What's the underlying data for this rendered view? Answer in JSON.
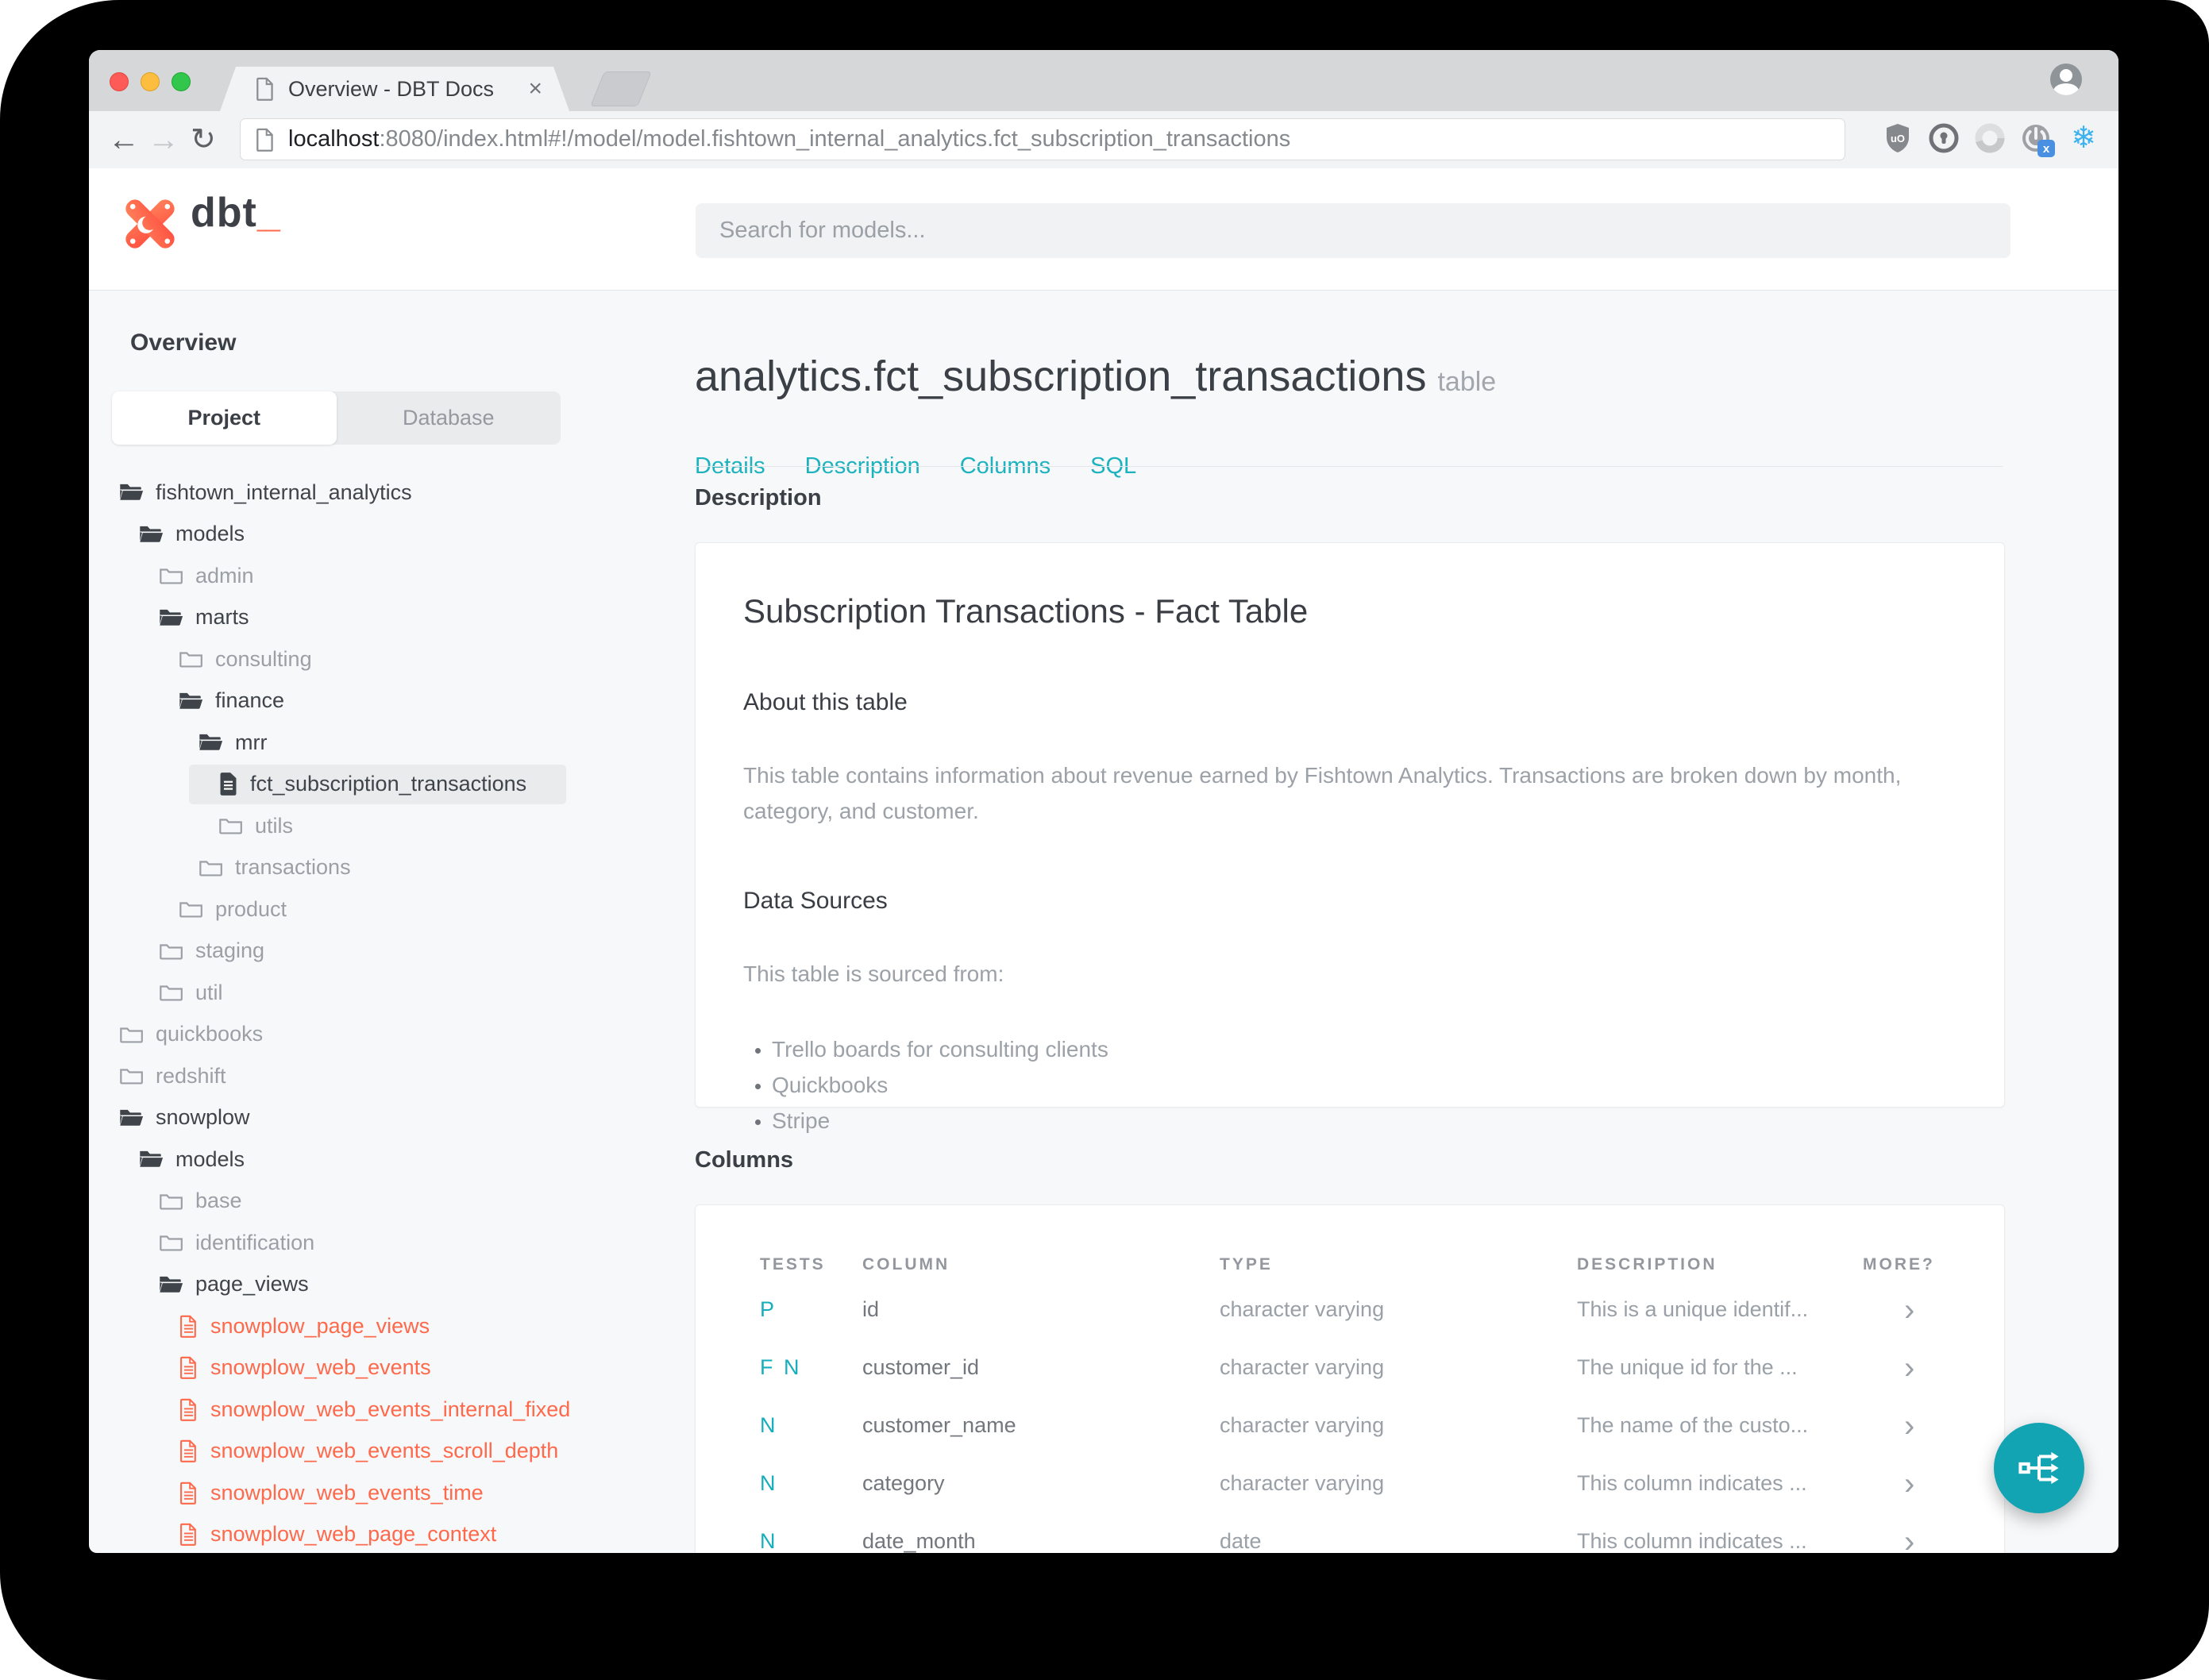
{
  "browser": {
    "tab_title": "Overview - DBT Docs",
    "tab_close_glyph": "×",
    "url": {
      "host": "localhost",
      "rest": ":8080/index.html#!/model/model.fishtown_internal_analytics.fct_subscription_transactions"
    },
    "nav_glyphs": {
      "back": "←",
      "forward": "→",
      "reload": "↻"
    },
    "extension_icons": [
      "shield-icon",
      "keyhole-icon",
      "ring-icon",
      "power-icon",
      "snowflake-icon",
      "overflow-menu-icon"
    ],
    "snowflake_glyph": "❄",
    "menu_glyph": "⋮",
    "ublock_label": "uO",
    "power_badge": "x"
  },
  "header": {
    "logo_text": "dbt",
    "logo_cursor": "_",
    "search_placeholder": "Search for models..."
  },
  "sidebar": {
    "overview_label": "Overview",
    "tabs": {
      "project": "Project",
      "database": "Database"
    },
    "tree": [
      {
        "label": "fishtown_internal_analytics",
        "icon": "folder-open",
        "tone": "dark",
        "indent": 0
      },
      {
        "label": "models",
        "icon": "folder-open",
        "tone": "dark",
        "indent": 1
      },
      {
        "label": "admin",
        "icon": "folder",
        "tone": "muted",
        "indent": 2
      },
      {
        "label": "marts",
        "icon": "folder-open",
        "tone": "dark",
        "indent": 2
      },
      {
        "label": "consulting",
        "icon": "folder",
        "tone": "muted",
        "indent": 3
      },
      {
        "label": "finance",
        "icon": "folder-open",
        "tone": "dark",
        "indent": 3
      },
      {
        "label": "mrr",
        "icon": "folder-open",
        "tone": "dark",
        "indent": 4
      },
      {
        "label": "fct_subscription_transactions",
        "icon": "file-solid",
        "tone": "dark",
        "indent": 5,
        "selected": true
      },
      {
        "label": "utils",
        "icon": "folder",
        "tone": "muted",
        "indent": 5
      },
      {
        "label": "transactions",
        "icon": "folder",
        "tone": "muted",
        "indent": 4
      },
      {
        "label": "product",
        "icon": "folder",
        "tone": "muted",
        "indent": 3
      },
      {
        "label": "staging",
        "icon": "folder",
        "tone": "muted",
        "indent": 2
      },
      {
        "label": "util",
        "icon": "folder",
        "tone": "muted",
        "indent": 2
      },
      {
        "label": "quickbooks",
        "icon": "folder",
        "tone": "muted",
        "indent": 0
      },
      {
        "label": "redshift",
        "icon": "folder",
        "tone": "muted",
        "indent": 0
      },
      {
        "label": "snowplow",
        "icon": "folder-open",
        "tone": "dark",
        "indent": 0
      },
      {
        "label": "models",
        "icon": "folder-open",
        "tone": "dark",
        "indent": 1
      },
      {
        "label": "base",
        "icon": "folder",
        "tone": "muted",
        "indent": 2
      },
      {
        "label": "identification",
        "icon": "folder",
        "tone": "muted",
        "indent": 2
      },
      {
        "label": "page_views",
        "icon": "folder-open",
        "tone": "dark",
        "indent": 2
      },
      {
        "label": "snowplow_page_views",
        "icon": "file-outline",
        "tone": "accent",
        "indent": 3
      },
      {
        "label": "snowplow_web_events",
        "icon": "file-outline",
        "tone": "accent",
        "indent": 3
      },
      {
        "label": "snowplow_web_events_internal_fixed",
        "icon": "file-outline",
        "tone": "accent",
        "indent": 3
      },
      {
        "label": "snowplow_web_events_scroll_depth",
        "icon": "file-outline",
        "tone": "accent",
        "indent": 3
      },
      {
        "label": "snowplow_web_events_time",
        "icon": "file-outline",
        "tone": "accent",
        "indent": 3
      },
      {
        "label": "snowplow_web_page_context",
        "icon": "file-outline",
        "tone": "accent",
        "indent": 3
      }
    ]
  },
  "main": {
    "title": "analytics.fct_subscription_transactions",
    "title_suffix": "table",
    "nav": [
      "Details",
      "Description",
      "Columns",
      "SQL"
    ],
    "description_section": {
      "heading": "Description",
      "card_title": "Subscription Transactions - Fact Table",
      "about_heading": "About this table",
      "about_text": "This table contains information about revenue earned by Fishtown Analytics. Transactions are broken down by month, category, and customer.",
      "sources_heading": "Data Sources",
      "sources_intro": "This table is sourced from:",
      "sources": [
        "Trello boards for consulting clients",
        "Quickbooks",
        "Stripe"
      ]
    },
    "columns_section": {
      "heading": "Columns",
      "headers": [
        "TESTS",
        "COLUMN",
        "TYPE",
        "DESCRIPTION",
        "MORE?"
      ],
      "more_glyph": "›",
      "rows": [
        {
          "tests": "P",
          "column": "id",
          "type": "character varying",
          "description": "This is a unique identif..."
        },
        {
          "tests": "F N",
          "column": "customer_id",
          "type": "character varying",
          "description": "The unique id for the ..."
        },
        {
          "tests": "N",
          "column": "customer_name",
          "type": "character varying",
          "description": "The name of the custo..."
        },
        {
          "tests": "N",
          "column": "category",
          "type": "character varying",
          "description": "This column indicates ..."
        },
        {
          "tests": "N",
          "column": "date_month",
          "type": "date",
          "description": "This column indicates ..."
        }
      ]
    }
  },
  "fab": {
    "icon": "lineage-graph-icon"
  },
  "theme": {
    "accent_teal": "#16aebb",
    "link_teal": "#1cb2be",
    "brand_orange": "#ff694b",
    "fab_teal": "#12a4b3",
    "page_bg": "#f7f8fa",
    "dark_text": "#3b4046",
    "muted_text": "#9aa0a7"
  }
}
